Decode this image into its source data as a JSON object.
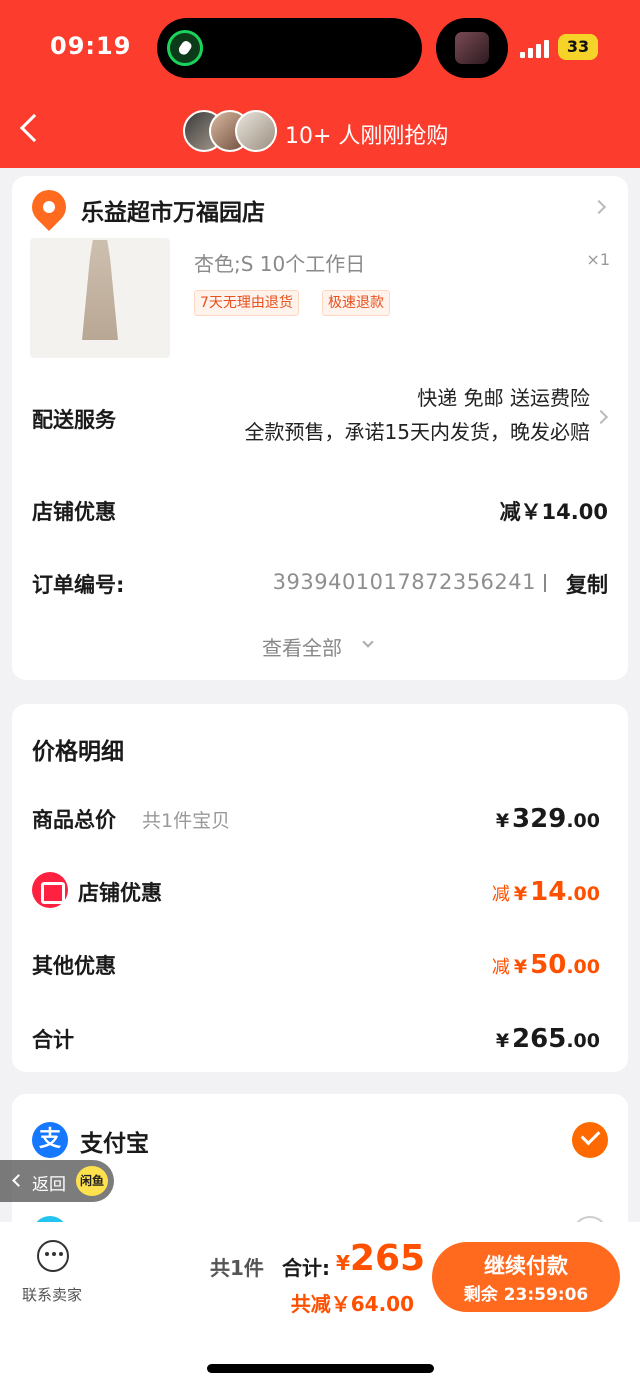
{
  "status_bar": {
    "time": "09:19",
    "battery": "33"
  },
  "header": {
    "text": "10+ 人刚刚抢购"
  },
  "shop": {
    "name": "乐益超市万福园店"
  },
  "product": {
    "sku": "杏色;S 10个工作日",
    "qty": "×1",
    "tags": [
      "7天无理由退货",
      "极速退款"
    ]
  },
  "delivery": {
    "label": "配送服务",
    "line1": "快递 免邮 送运费险",
    "line2": "全款预售，承诺15天内发货，晚发必赔"
  },
  "shop_discount": {
    "label": "店铺优惠",
    "value": "减￥14.00"
  },
  "order": {
    "label": "订单编号:",
    "number": "3939401017872356241",
    "copy": "复制"
  },
  "view_all": "查看全部",
  "price_detail": {
    "title": "价格明细",
    "items_total_label": "商品总价",
    "items_total_sub": "共1件宝贝",
    "items_total": {
      "yen": "¥",
      "int": "329",
      "dec": ".00"
    },
    "shop_discount_label": "店铺优惠",
    "shop_discount": {
      "prefix": "减",
      "yen": "¥",
      "int": "14",
      "dec": ".00"
    },
    "other_discount_label": "其他优惠",
    "other_discount": {
      "prefix": "减",
      "yen": "¥",
      "int": "50",
      "dec": ".00"
    },
    "total_label": "合计",
    "total": {
      "yen": "¥",
      "int": "265",
      "dec": ".00"
    }
  },
  "payment": {
    "alipay_icon": "支",
    "alipay": "支付宝"
  },
  "return_pill": {
    "text": "返回",
    "badge": "闲鱼"
  },
  "bottom": {
    "contact": "联系卖家",
    "count": "共1件",
    "total_label": "合计:",
    "total_yen": "¥",
    "total_value": "265",
    "saved": "共减￥64.00",
    "pay_button": "继续付款",
    "countdown": "剩余 23:59:06"
  },
  "colors": {
    "brand_red": "#fc3d2d",
    "accent_orange": "#ff5000"
  }
}
